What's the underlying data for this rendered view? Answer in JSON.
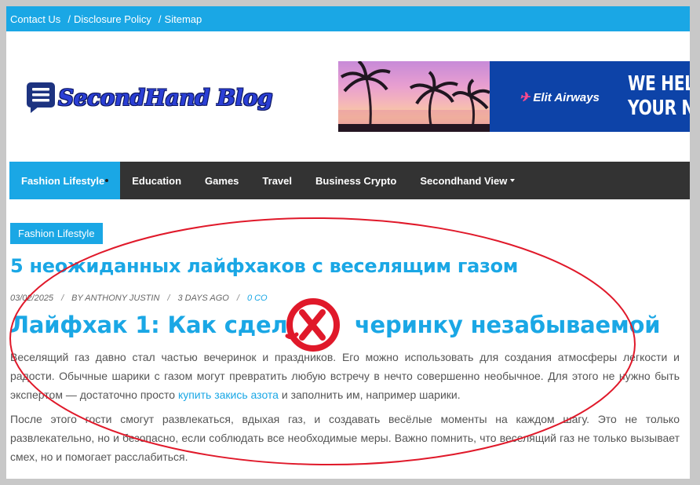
{
  "topbar": {
    "links": [
      "Contact Us",
      "Disclosure Policy",
      "Sitemap"
    ],
    "separator": "/"
  },
  "logo": {
    "text": "SecondHand Blog",
    "icon": "chat-menu-icon"
  },
  "banner": {
    "airline": "Elit Airways",
    "promo_line1": "WE HELP",
    "promo_line2": "YOUR N"
  },
  "nav": {
    "items": [
      "Fashion Lifestyle",
      "Education",
      "Games",
      "Travel",
      "Business Crypto",
      "Secondhand View"
    ]
  },
  "post": {
    "category": "Fashion Lifestyle",
    "title": "5 неожиданных лайфхаков с веселящим газом",
    "date": "03/02/2025",
    "author": "BY ANTHONY JUSTIN",
    "ago": "3 DAYS AGO",
    "comments": "0 CO",
    "meta_separator": "/",
    "h2_left": "Лайфхак 1: Как сдела",
    "h2_right": "черинку незабываемой",
    "p1_before": "Веселящий газ давно стал частью вечеринок и праздников. Его можно использовать для создания атмосферы легкости и радости. Обычные шарики с газом могут превратить любую встречу в нечто совершенно необычное. Для этого не нужно быть экспертом — достаточно просто ",
    "p1_link": "купить закись азота",
    "p1_after": " и заполнить им, например шарики.",
    "p2": "После этого гости смогут развлекаться, вдыхая газ, и создавать весёлые моменты на каждом шагу. Это не только развлекательно, но и безопасно, если соблюдать все необходимые меры. Важно помнить, что веселящий газ не только вызывает смех, но и помогает расслабиться."
  },
  "colors": {
    "accent": "#1aa7e5",
    "nav_bg": "#333333",
    "annotation_red": "#e0192a"
  }
}
